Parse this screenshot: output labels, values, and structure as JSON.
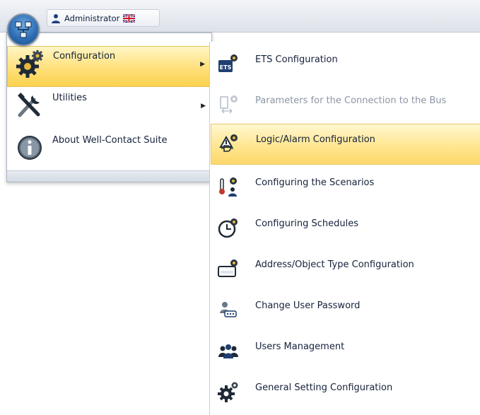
{
  "titlebar": {
    "user": "Administrator",
    "user_icon": "user-icon",
    "flag_icon": "uk-flag-icon",
    "app_icon": "network-app-icon"
  },
  "left_menu": {
    "items": [
      {
        "label": "Configuration",
        "icon": "gears-icon",
        "has_submenu": true,
        "active": true
      },
      {
        "label": "Utilities",
        "icon": "tools-icon",
        "has_submenu": true,
        "active": false
      },
      {
        "label": "About Well-Contact Suite",
        "icon": "info-icon",
        "has_submenu": false,
        "active": false
      }
    ]
  },
  "submenu": {
    "items": [
      {
        "label": "ETS Configuration",
        "icon": "ets-config-icon",
        "state": "normal"
      },
      {
        "label": "Parameters for the Connection to the Bus",
        "icon": "bus-connection-icon",
        "state": "disabled"
      },
      {
        "label": "Logic/Alarm Configuration",
        "icon": "logic-alarm-icon",
        "state": "highlighted"
      },
      {
        "label": "Configuring the Scenarios",
        "icon": "scenarios-icon",
        "state": "normal"
      },
      {
        "label": "Configuring Schedules",
        "icon": "schedules-clock-icon",
        "state": "normal"
      },
      {
        "label": "Address/Object Type Configuration",
        "icon": "address-object-icon",
        "state": "normal"
      },
      {
        "label": "Change User Password",
        "icon": "user-password-icon",
        "state": "normal"
      },
      {
        "label": "Users Management",
        "icon": "users-management-icon",
        "state": "normal"
      },
      {
        "label": "General Setting Configuration",
        "icon": "general-settings-gear-icon",
        "state": "normal"
      }
    ]
  },
  "colors": {
    "highlight": "#ffe07a",
    "text": "#15213a",
    "disabled_text": "#8c96a6"
  }
}
